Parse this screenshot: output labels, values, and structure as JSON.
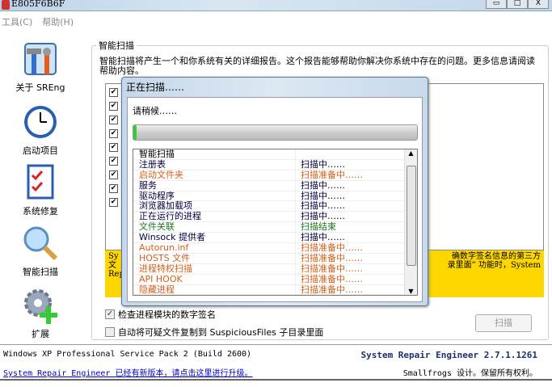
{
  "window": {
    "title": "E805F6B6F",
    "controls": [
      "▭",
      "□",
      "X"
    ]
  },
  "menu": [
    "工具(C)",
    "帮助(H)"
  ],
  "sidebar": [
    {
      "label": "关于 SREng",
      "icon": "tools-icon"
    },
    {
      "label": "启动项目",
      "icon": "clock-icon"
    },
    {
      "label": "系统修复",
      "icon": "checklist-icon"
    },
    {
      "label": "智能扫描",
      "icon": "magnifier-icon"
    },
    {
      "label": "扩展",
      "icon": "gear-plus-icon"
    }
  ],
  "group": {
    "title": "智能扫描",
    "description": "智能扫描将产生一个和你系统有关的详细报告。这个报告能够帮助你解决你系统中存在的问题。更多信息请阅读帮助内容。"
  },
  "notice": {
    "left": [
      "Sy",
      "文",
      "Rep"
    ],
    "right": [
      "确数字签名信息的第三方",
      "录里面” 功能时，System"
    ]
  },
  "options": [
    {
      "label": "检查进程模块的数字签名",
      "checked": true
    },
    {
      "label": "自动将可疑文件复制到 SuspiciousFiles 子目录里面",
      "checked": false
    }
  ],
  "scan_button": "扫描",
  "status": {
    "os": "Windows XP Professional Service Pack 2 (Build 2600)",
    "update_link": "System Repair Engineer 已经有新版本，请点击这里进行升级。",
    "product": "System Repair Engineer 2.7.1.1261",
    "credit": "Smallfrogs 设计。保留所有权利。"
  },
  "dialog": {
    "title": "正在扫描……",
    "wait": "请稍候……",
    "progress": 0.01,
    "rows": [
      {
        "name": "智能扫描",
        "status": "",
        "color": "#000000"
      },
      {
        "name": "注册表",
        "status": "扫描中……",
        "color": "#000040"
      },
      {
        "name": "启动文件夹",
        "status": "扫描准备中……",
        "color": "#d2601a"
      },
      {
        "name": "服务",
        "status": "扫描中……",
        "color": "#000040"
      },
      {
        "name": "驱动程序",
        "status": "扫描中……",
        "color": "#000040"
      },
      {
        "name": "浏览器加载项",
        "status": "扫描中……",
        "color": "#000040"
      },
      {
        "name": "正在运行的进程",
        "status": "扫描中……",
        "color": "#000040"
      },
      {
        "name": "文件关联",
        "status": "扫描结束",
        "color": "#1a7a1a"
      },
      {
        "name": "Winsock 提供者",
        "status": "扫描中……",
        "color": "#000040"
      },
      {
        "name": "Autorun.inf",
        "status": "扫描准备中……",
        "color": "#d2601a"
      },
      {
        "name": "HOSTS 文件",
        "status": "扫描准备中……",
        "color": "#d2601a"
      },
      {
        "name": "进程特权扫描",
        "status": "扫描准备中……",
        "color": "#d2601a"
      },
      {
        "name": "API HOOK",
        "status": "扫描准备中……",
        "color": "#d2601a"
      },
      {
        "name": "隐藏进程",
        "status": "扫描准备中……",
        "color": "#d2601a"
      }
    ]
  }
}
